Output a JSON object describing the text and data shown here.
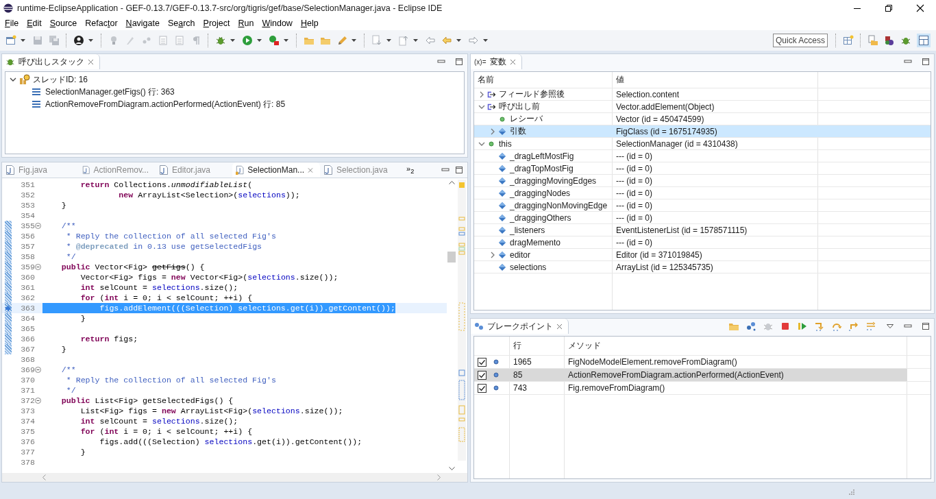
{
  "window": {
    "title": "runtime-EclipseApplication - GEF-0.13.7/GEF-0.13.7-src/org/tigris/gef/base/SelectionManager.java - Eclipse IDE"
  },
  "menu": [
    {
      "key": "F",
      "post": "ile"
    },
    {
      "key": "E",
      "post": "dit"
    },
    {
      "key": "S",
      "post": "ource"
    },
    {
      "pre": "Refac",
      "key": "t",
      "post": "or"
    },
    {
      "key": "N",
      "post": "avigate"
    },
    {
      "pre": "Se",
      "key": "a",
      "post": "rch"
    },
    {
      "key": "P",
      "post": "roject"
    },
    {
      "key": "R",
      "post": "un"
    },
    {
      "key": "W",
      "post": "indow"
    },
    {
      "key": "H",
      "post": "elp"
    }
  ],
  "quick_access": {
    "placeholder": "Quick Access"
  },
  "call_stack": {
    "title": "呼び出しスタック",
    "thread": {
      "label": "スレッドID: 16",
      "expanded": true,
      "frames": [
        {
          "label": "SelectionManager.getFigs() 行: 363"
        },
        {
          "label": "ActionRemoveFromDiagram.actionPerformed(ActionEvent) 行: 85"
        }
      ]
    }
  },
  "editor": {
    "tabs": [
      {
        "label": "Fig.java",
        "selected": false
      },
      {
        "label": "ActionRemov...",
        "selected": false
      },
      {
        "label": "Editor.java",
        "selected": false
      },
      {
        "label": "SelectionMan...",
        "selected": true
      },
      {
        "label": "Selection.java",
        "selected": false
      }
    ],
    "overflow": "»$_{2}$",
    "lines": [
      {
        "number": "351",
        "foldable": false,
        "in_range": false,
        "current": false,
        "tokens": [
          {
            "kind": "keyword",
            "text": "        return"
          },
          {
            "kind": "plain",
            "text": " Collections."
          },
          {
            "kind": "static",
            "text": "unmodifiableList"
          },
          {
            "kind": "plain",
            "text": "("
          }
        ]
      },
      {
        "number": "352",
        "foldable": false,
        "in_range": false,
        "current": false,
        "tokens": [
          {
            "kind": "keyword",
            "text": "                new"
          },
          {
            "kind": "plain",
            "text": " ArrayList<Selection>("
          },
          {
            "kind": "field",
            "text": "selections"
          },
          {
            "kind": "plain",
            "text": "));"
          }
        ]
      },
      {
        "number": "353",
        "foldable": false,
        "in_range": false,
        "current": false,
        "tokens": [
          {
            "kind": "plain",
            "text": "    }"
          }
        ]
      },
      {
        "number": "354",
        "foldable": false,
        "in_range": false,
        "current": false
      },
      {
        "number": "355",
        "foldable": true,
        "in_range": true,
        "current": false,
        "tokens": [
          {
            "kind": "comment",
            "text": "    /**"
          }
        ]
      },
      {
        "number": "356",
        "foldable": false,
        "in_range": true,
        "current": false,
        "tokens": [
          {
            "kind": "comment",
            "text": "     * Reply the collection of all selected Fig's"
          }
        ]
      },
      {
        "number": "357",
        "foldable": false,
        "in_range": true,
        "current": false,
        "tokens": [
          {
            "kind": "comment",
            "text": "     * "
          },
          {
            "kind": "doctag",
            "text": "@deprecated"
          },
          {
            "kind": "comment",
            "text": " in 0.13 use getSelectedFigs"
          }
        ]
      },
      {
        "number": "358",
        "foldable": false,
        "in_range": true,
        "current": false,
        "tokens": [
          {
            "kind": "comment",
            "text": "     */"
          }
        ]
      },
      {
        "number": "359",
        "foldable": true,
        "in_range": true,
        "current": false,
        "tokens": [
          {
            "kind": "keyword",
            "text": "    public"
          },
          {
            "kind": "plain",
            "text": " Vector<Fig> "
          },
          {
            "kind": "deprecated",
            "text": "getFigs"
          },
          {
            "kind": "plain",
            "text": "() {"
          }
        ]
      },
      {
        "number": "360",
        "foldable": false,
        "in_range": true,
        "current": false,
        "tokens": [
          {
            "kind": "plain",
            "text": "        Vector<Fig> figs = "
          },
          {
            "kind": "keyword",
            "text": "new"
          },
          {
            "kind": "plain",
            "text": " Vector<Fig>("
          },
          {
            "kind": "field",
            "text": "selections"
          },
          {
            "kind": "plain",
            "text": ".size());"
          }
        ]
      },
      {
        "number": "361",
        "foldable": false,
        "in_range": true,
        "current": false,
        "tokens": [
          {
            "kind": "keyword",
            "text": "        int"
          },
          {
            "kind": "plain",
            "text": " selCount = "
          },
          {
            "kind": "field",
            "text": "selections"
          },
          {
            "kind": "plain",
            "text": ".size();"
          }
        ]
      },
      {
        "number": "362",
        "foldable": false,
        "in_range": true,
        "current": false,
        "tokens": [
          {
            "kind": "keyword",
            "text": "        for"
          },
          {
            "kind": "plain",
            "text": " ("
          },
          {
            "kind": "keyword",
            "text": "int"
          },
          {
            "kind": "plain",
            "text": " i = 0; i < selCount; ++i) {"
          }
        ]
      },
      {
        "number": "363",
        "foldable": false,
        "in_range": true,
        "current": true,
        "tokens": [
          {
            "kind": "plain",
            "text": "            figs.addElement(((Selection) selections.get(i)).getContent());"
          }
        ]
      },
      {
        "number": "364",
        "foldable": false,
        "in_range": true,
        "current": false,
        "tokens": [
          {
            "kind": "plain",
            "text": "        }"
          }
        ]
      },
      {
        "number": "365",
        "foldable": false,
        "in_range": true,
        "current": false
      },
      {
        "number": "366",
        "foldable": false,
        "in_range": true,
        "current": false,
        "tokens": [
          {
            "kind": "keyword",
            "text": "        return"
          },
          {
            "kind": "plain",
            "text": " figs;"
          }
        ]
      },
      {
        "number": "367",
        "foldable": false,
        "in_range": true,
        "current": false,
        "tokens": [
          {
            "kind": "plain",
            "text": "    }"
          }
        ]
      },
      {
        "number": "368",
        "foldable": false,
        "in_range": false,
        "current": false
      },
      {
        "number": "369",
        "foldable": true,
        "in_range": false,
        "current": false,
        "tokens": [
          {
            "kind": "comment",
            "text": "    /**"
          }
        ]
      },
      {
        "number": "370",
        "foldable": false,
        "in_range": false,
        "current": false,
        "tokens": [
          {
            "kind": "comment",
            "text": "     * Reply the collection of all selected Fig's"
          }
        ]
      },
      {
        "number": "371",
        "foldable": false,
        "in_range": false,
        "current": false,
        "tokens": [
          {
            "kind": "comment",
            "text": "     */"
          }
        ]
      },
      {
        "number": "372",
        "foldable": true,
        "in_range": false,
        "current": false,
        "tokens": [
          {
            "kind": "keyword",
            "text": "    public"
          },
          {
            "kind": "plain",
            "text": " List<Fig> getSelectedFigs() {"
          }
        ]
      },
      {
        "number": "373",
        "foldable": false,
        "in_range": false,
        "current": false,
        "tokens": [
          {
            "kind": "plain",
            "text": "        List<Fig> figs = "
          },
          {
            "kind": "keyword",
            "text": "new"
          },
          {
            "kind": "plain",
            "text": " ArrayList<Fig>("
          },
          {
            "kind": "field",
            "text": "selections"
          },
          {
            "kind": "plain",
            "text": ".size());"
          }
        ]
      },
      {
        "number": "374",
        "foldable": false,
        "in_range": false,
        "current": false,
        "tokens": [
          {
            "kind": "keyword",
            "text": "        int"
          },
          {
            "kind": "plain",
            "text": " selCount = "
          },
          {
            "kind": "field",
            "text": "selections"
          },
          {
            "kind": "plain",
            "text": ".size();"
          }
        ]
      },
      {
        "number": "375",
        "foldable": false,
        "in_range": false,
        "current": false,
        "tokens": [
          {
            "kind": "keyword",
            "text": "        for"
          },
          {
            "kind": "plain",
            "text": " ("
          },
          {
            "kind": "keyword",
            "text": "int"
          },
          {
            "kind": "plain",
            "text": " i = 0; i < selCount; ++i) {"
          }
        ]
      },
      {
        "number": "376",
        "foldable": false,
        "in_range": false,
        "current": false,
        "tokens": [
          {
            "kind": "plain",
            "text": "            figs.add(((Selection) "
          },
          {
            "kind": "field",
            "text": "selections"
          },
          {
            "kind": "plain",
            "text": ".get(i)).getContent());"
          }
        ]
      },
      {
        "number": "377",
        "foldable": false,
        "in_range": false,
        "current": false,
        "tokens": [
          {
            "kind": "plain",
            "text": "        }"
          }
        ]
      },
      {
        "number": "378",
        "foldable": false,
        "in_range": false,
        "current": false
      }
    ]
  },
  "variables": {
    "icon_text": "(x)=",
    "title": "変数",
    "columns": [
      "名前",
      "値"
    ],
    "rows": [
      {
        "name": "フィールド参照後",
        "value": "Selection.content",
        "kind": "return",
        "expanded": false,
        "selected": false
      },
      {
        "name": "呼び出し前",
        "value": "Vector.addElement(Object)",
        "kind": "return",
        "expanded": true,
        "selected": false,
        "children": [
          {
            "name": "レシーバ",
            "value": "Vector (id = 450474599)",
            "kind": "local",
            "selected": false
          },
          {
            "name": "引数",
            "value": "FigClass (id = 1675174935)",
            "kind": "field",
            "expanded": false,
            "selected": true
          }
        ]
      },
      {
        "name": "this",
        "value": "SelectionManager (id = 4310438)",
        "kind": "local",
        "expanded": true,
        "selected": false,
        "children": [
          {
            "name": "_dragLeftMostFig",
            "value": "--- (id = 0)",
            "kind": "field",
            "selected": false
          },
          {
            "name": "_dragTopMostFig",
            "value": "--- (id = 0)",
            "kind": "field",
            "selected": false
          },
          {
            "name": "_draggingMovingEdges",
            "value": "--- (id = 0)",
            "kind": "field",
            "selected": false
          },
          {
            "name": "_draggingNodes",
            "value": "--- (id = 0)",
            "kind": "field",
            "selected": false
          },
          {
            "name": "_draggingNonMovingEdge",
            "value": "--- (id = 0)",
            "kind": "field",
            "selected": false
          },
          {
            "name": "_draggingOthers",
            "value": "--- (id = 0)",
            "kind": "field",
            "selected": false
          },
          {
            "name": "_listeners",
            "value": "EventListenerList (id = 1578571115)",
            "kind": "field",
            "selected": false
          },
          {
            "name": "dragMemento",
            "value": "--- (id = 0)",
            "kind": "field",
            "selected": false
          },
          {
            "name": "editor",
            "value": "Editor (id = 371019845)",
            "kind": "field",
            "expanded": false,
            "selected": false
          },
          {
            "name": "selections",
            "value": "ArrayList (id = 125345735)",
            "kind": "field",
            "selected": false
          }
        ]
      }
    ]
  },
  "breakpoints": {
    "title": "ブレークポイント",
    "columns": [
      "行",
      "メソッド"
    ],
    "rows": [
      {
        "checked": true,
        "selected": false,
        "line": "1965",
        "method": "FigNodeModelElement.removeFromDiagram()"
      },
      {
        "checked": true,
        "selected": true,
        "line": "85",
        "method": "ActionRemoveFromDiagram.actionPerformed(ActionEvent)"
      },
      {
        "checked": true,
        "selected": false,
        "line": "743",
        "method": "Fig.removeFromDiagram()"
      }
    ]
  }
}
